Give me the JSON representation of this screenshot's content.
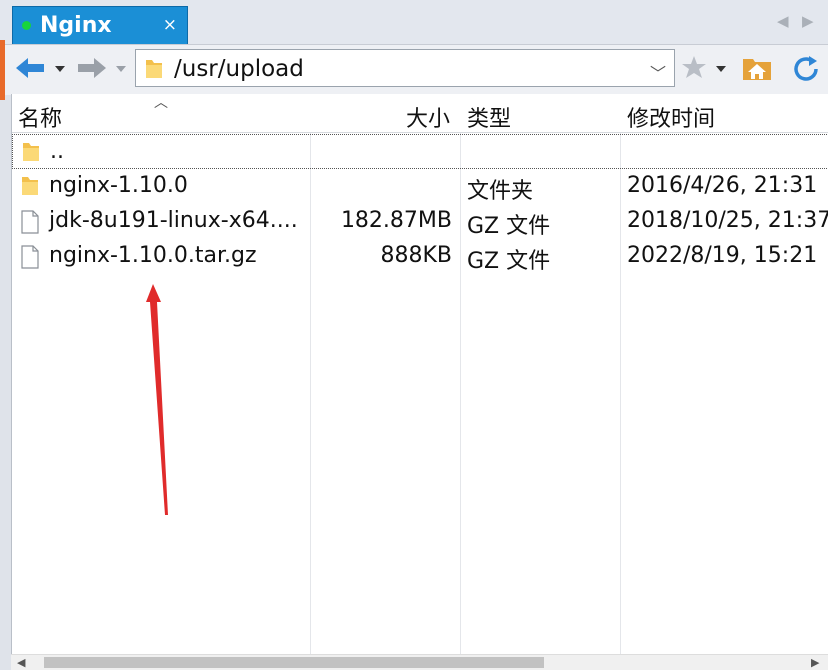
{
  "tab": {
    "title": "Nginx",
    "close": "×"
  },
  "tab_nav": {
    "left": "◀",
    "right": "▶"
  },
  "address": {
    "path": "/usr/upload",
    "dropdown": "﹀"
  },
  "columns": {
    "name": "名称",
    "size": "大小",
    "type": "类型",
    "modified": "修改时间"
  },
  "files": [
    {
      "icon": "folder-icon",
      "name": "..",
      "size": "",
      "type": "",
      "modified": ""
    },
    {
      "icon": "folder-icon",
      "name": "nginx-1.10.0",
      "size": "",
      "type": "文件夹",
      "modified": "2016/4/26, 21:31"
    },
    {
      "icon": "file-icon",
      "name": "jdk-8u191-linux-x64....",
      "size": "182.87MB",
      "type": "GZ 文件",
      "modified": "2018/10/25, 21:37"
    },
    {
      "icon": "file-icon",
      "name": "nginx-1.10.0.tar.gz",
      "size": "888KB",
      "type": "GZ 文件",
      "modified": "2022/8/19, 15:21"
    }
  ],
  "scroll": {
    "left": "◀",
    "right": "▶"
  },
  "colors": {
    "tab_bg": "#1b8fd6",
    "status_dot": "#18d43e",
    "annotation": "#e02b2b",
    "nav_arrow": "#2f86d6"
  }
}
